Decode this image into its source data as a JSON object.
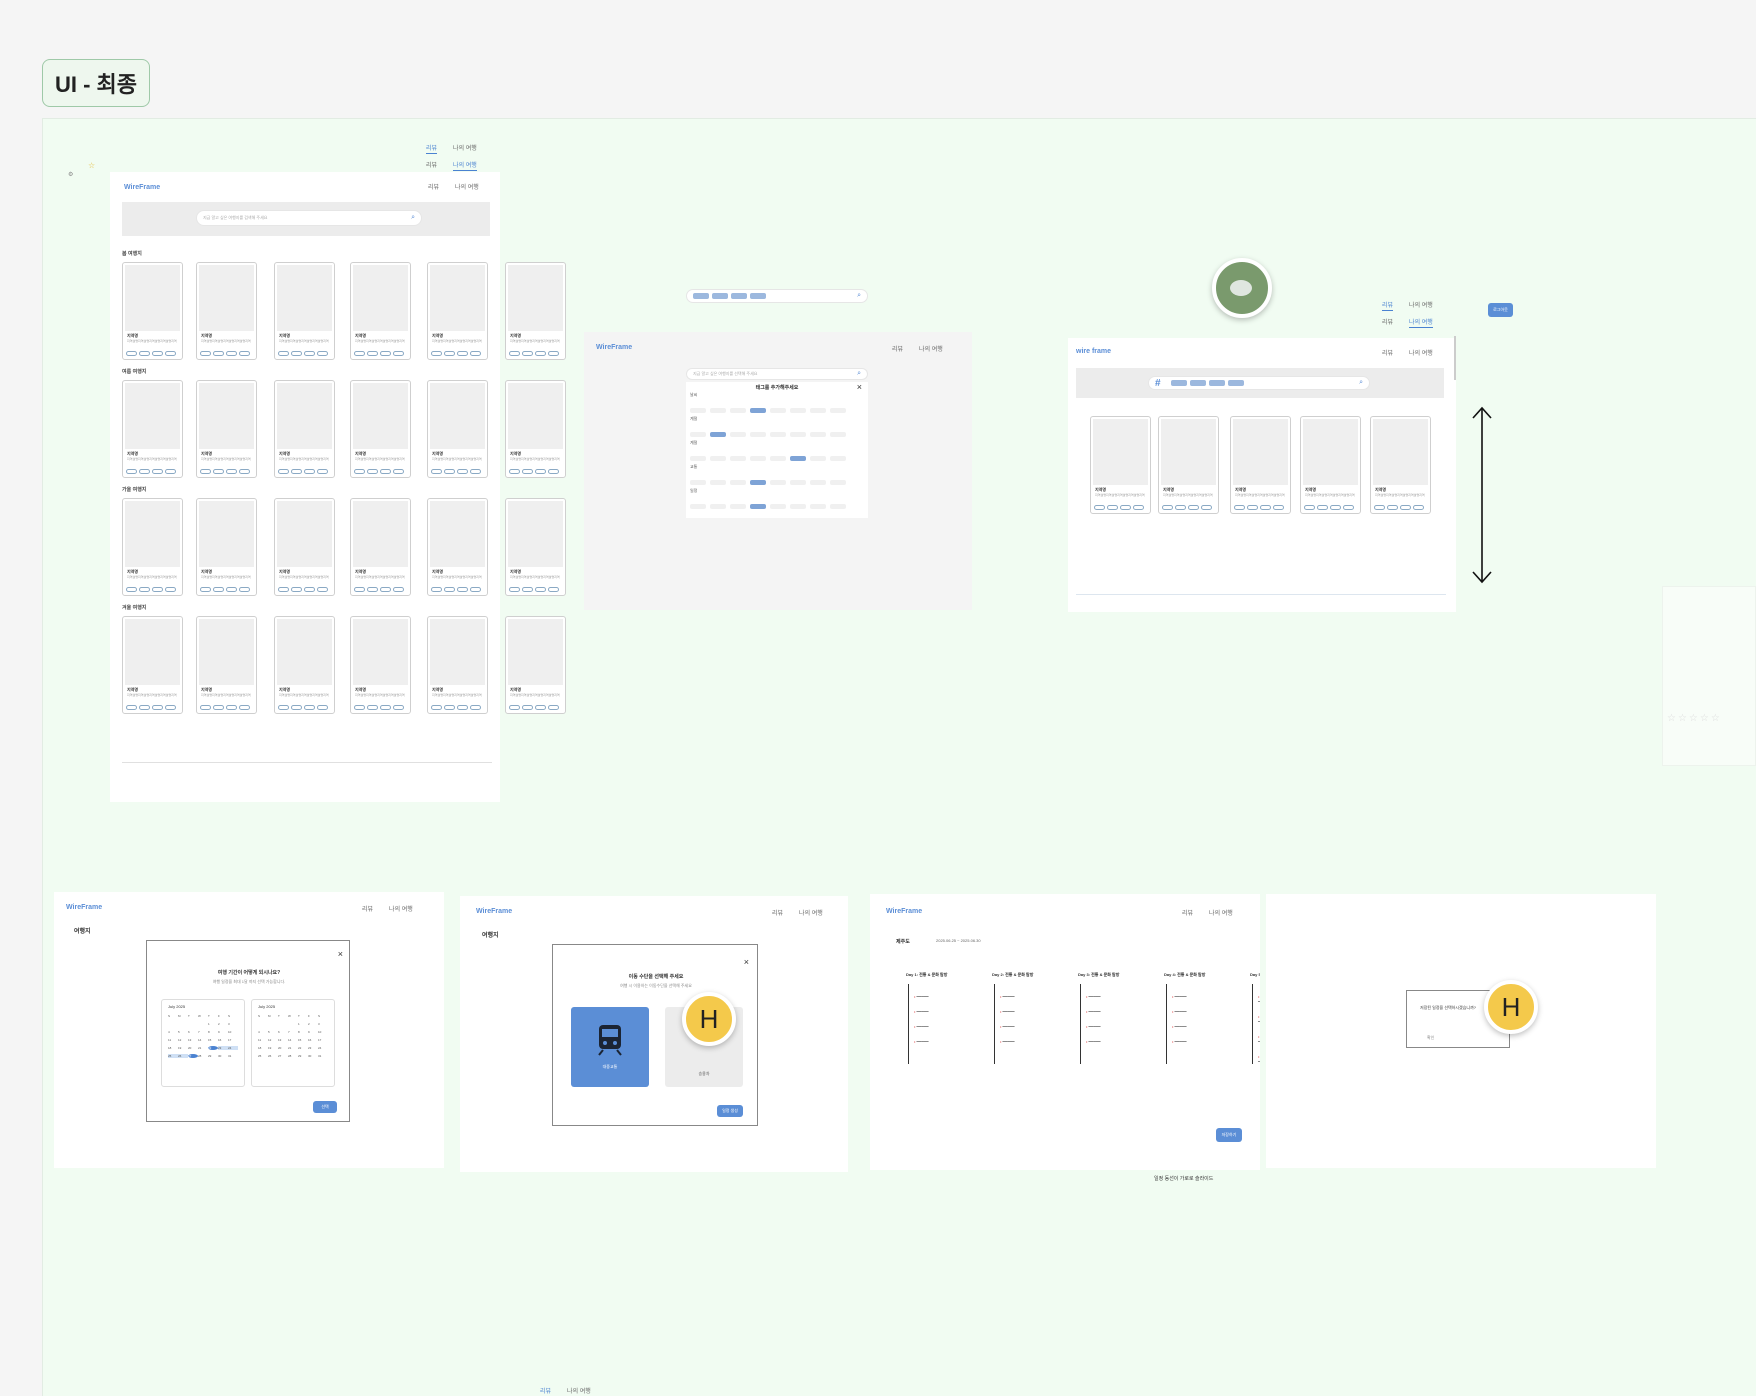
{
  "section_title": "UI - 최종",
  "logo": "WireFrame",
  "logo_lower": "wire frame",
  "nav": {
    "review": "리뷰",
    "my_trip": "나의 여행"
  },
  "main": {
    "search_placeholder": "지금 알고 싶은 여행지를 검색해 주세요",
    "sections": [
      "봄 여행지",
      "여름 여행지",
      "가을 여행지",
      "겨울 여행지"
    ],
    "card_title": "지역명",
    "card_desc": "지역설명지역설명지역설명지역설명지역"
  },
  "tag_modal": {
    "title": "태그를 추가해주세요",
    "search_placeholder": "지금 알고 싶은 여행지를 선택해 주세요",
    "groups": [
      "날씨",
      "계절",
      "계절",
      "교통",
      "일정"
    ]
  },
  "top_small_button": "로그아웃",
  "date_modal": {
    "page_title": "여행지",
    "title": "여행 기간이 어떻게 되시나요?",
    "subtitle": "여행 일정을 최대 1달 까지 선택 가능합니다.",
    "month1": "July 2025",
    "month2": "July 2025",
    "weekdays": [
      "S",
      "M",
      "T",
      "W",
      "T",
      "F",
      "S"
    ],
    "confirm": "선택"
  },
  "transport_modal": {
    "page_title": "여행지",
    "title": "이동 수단을 선택해 주세요",
    "subtitle": "여행 시 이용하는 이동수단을 선택해 주세요",
    "option1": "대중교통",
    "option2": "승용차",
    "next": "일정 생성"
  },
  "schedule": {
    "place": "제주도",
    "dates": "2025.06.25 ~ 2025.06.30",
    "days": [
      "Day 1: 전통 & 문화 탐방",
      "Day 2: 전통 & 문화 탐방",
      "Day 3: 전통 & 문화 탐방",
      "Day 4: 전통 & 문화 탐방",
      "Day 5: 전"
    ],
    "button": "저장하기",
    "caption": "일정 동선이 가로로 슬라이드"
  },
  "confirm_dialog": {
    "message": "저장된 일정을 선택하시겠습니까?",
    "yes": "확인"
  },
  "avatar_letter": "H",
  "bottom_nav": {
    "review": "리뷰",
    "my_trip": "나의 여행"
  }
}
